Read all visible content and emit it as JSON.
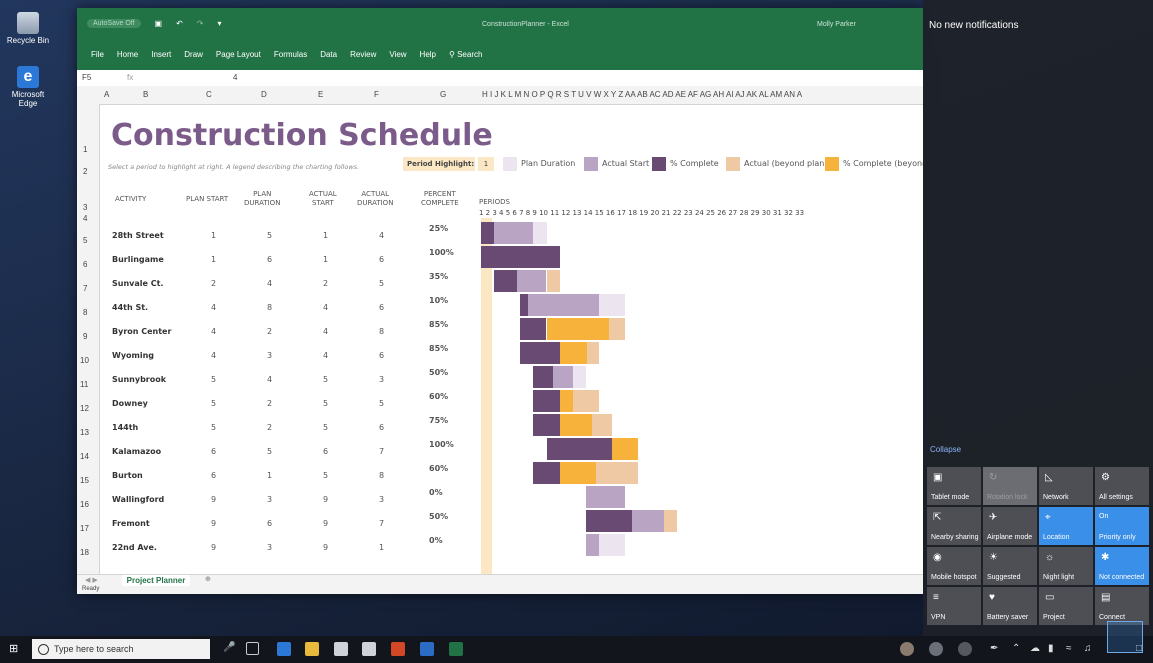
{
  "desktop": {
    "icons": [
      {
        "label": "Recycle Bin"
      },
      {
        "label": "Microsoft Edge"
      }
    ]
  },
  "excel": {
    "qat": {
      "autosave": "AutoSave",
      "autosave_state": "Off"
    },
    "doc_title": "ConstructionPlanner - Excel",
    "user": "Molly Parker",
    "menu": [
      "File",
      "Home",
      "Insert",
      "Draw",
      "Page Layout",
      "Formulas",
      "Data",
      "Review",
      "View",
      "Help",
      "Search"
    ],
    "formula": {
      "cell_ref": "F5",
      "fx": "fx",
      "value": "4"
    },
    "columns": [
      "A",
      "B",
      "C",
      "D",
      "E",
      "F",
      "G"
    ],
    "col_letters_rest": "H I J K L M N O P Q R S T U V W X Y Z AA AB AC AD AE AF AG AH AI AJ AK AL AM AN A",
    "rows": [
      "1",
      "2",
      "3",
      "4",
      "5",
      "6",
      "7",
      "8",
      "9",
      "10",
      "11",
      "12",
      "13",
      "14",
      "15",
      "16",
      "17",
      "18"
    ],
    "title": "Construction Schedule",
    "subtitle": "Select a period to highlight at right.  A legend describing the charting follows.",
    "period_highlight_label": "Period Highlight:",
    "period_highlight_value": "1",
    "legend": [
      {
        "label": "Plan Duration",
        "color": "#ece4ee"
      },
      {
        "label": "Actual Start",
        "color": "#b9a4c4"
      },
      {
        "label": "% Complete",
        "color": "#684a72"
      },
      {
        "label": "Actual (beyond plan)",
        "color": "#efc9a4"
      },
      {
        "label": "% Complete (beyond",
        "color": "#f6b23b"
      }
    ],
    "headers": {
      "activity": "ACTIVITY",
      "plan_start": "PLAN START",
      "plan_duration_1": "PLAN",
      "plan_duration_2": "DURATION",
      "actual_start_1": "ACTUAL",
      "actual_start_2": "START",
      "actual_duration_1": "ACTUAL",
      "actual_duration_2": "DURATION",
      "percent_1": "PERCENT",
      "percent_2": "COMPLETE",
      "periods": "PERIODS"
    },
    "period_numbers": "1  2  3  4  5  6  7  8  9  10  11  12  13  14  15  16  17  18  19  20  21  22  23  24  25  26  27  28  29  30  31  32  33",
    "activities": [
      {
        "name": "28th Street",
        "plan_start": "1",
        "plan_duration": "5",
        "actual_start": "1",
        "actual_duration": "4",
        "percent": "25%"
      },
      {
        "name": "Burlingame",
        "plan_start": "1",
        "plan_duration": "6",
        "actual_start": "1",
        "actual_duration": "6",
        "percent": "100%"
      },
      {
        "name": "Sunvale Ct.",
        "plan_start": "2",
        "plan_duration": "4",
        "actual_start": "2",
        "actual_duration": "5",
        "percent": "35%"
      },
      {
        "name": "44th St.",
        "plan_start": "4",
        "plan_duration": "8",
        "actual_start": "4",
        "actual_duration": "6",
        "percent": "10%"
      },
      {
        "name": "Byron Center",
        "plan_start": "4",
        "plan_duration": "2",
        "actual_start": "4",
        "actual_duration": "8",
        "percent": "85%"
      },
      {
        "name": "Wyoming",
        "plan_start": "4",
        "plan_duration": "3",
        "actual_start": "4",
        "actual_duration": "6",
        "percent": "85%"
      },
      {
        "name": "Sunnybrook",
        "plan_start": "5",
        "plan_duration": "4",
        "actual_start": "5",
        "actual_duration": "3",
        "percent": "50%"
      },
      {
        "name": "Downey",
        "plan_start": "5",
        "plan_duration": "2",
        "actual_start": "5",
        "actual_duration": "5",
        "percent": "60%"
      },
      {
        "name": "144th",
        "plan_start": "5",
        "plan_duration": "2",
        "actual_start": "5",
        "actual_duration": "6",
        "percent": "75%"
      },
      {
        "name": "Kalamazoo",
        "plan_start": "6",
        "plan_duration": "5",
        "actual_start": "6",
        "actual_duration": "7",
        "percent": "100%"
      },
      {
        "name": "Burton",
        "plan_start": "6",
        "plan_duration": "1",
        "actual_start": "5",
        "actual_duration": "8",
        "percent": "60%"
      },
      {
        "name": "Wallingford",
        "plan_start": "9",
        "plan_duration": "3",
        "actual_start": "9",
        "actual_duration": "3",
        "percent": "0%"
      },
      {
        "name": "Fremont",
        "plan_start": "9",
        "plan_duration": "6",
        "actual_start": "9",
        "actual_duration": "7",
        "percent": "50%"
      },
      {
        "name": "22nd Ave.",
        "plan_start": "9",
        "plan_duration": "3",
        "actual_start": "9",
        "actual_duration": "1",
        "percent": "0%"
      }
    ],
    "sheet_tab": "Project Planner",
    "status": "Ready"
  },
  "action_center": {
    "notifications": "No new notifications",
    "collapse": "Collapse",
    "tiles": [
      {
        "label": "Tablet mode",
        "icon": "tablet-mode-icon",
        "state": "off"
      },
      {
        "label": "Rotation lock",
        "icon": "rotation-lock-icon",
        "state": "dim"
      },
      {
        "label": "Network",
        "icon": "network-icon",
        "state": "off"
      },
      {
        "label": "All settings",
        "icon": "settings-icon",
        "state": "off"
      },
      {
        "label": "Nearby sharing",
        "icon": "nearby-sharing-icon",
        "state": "off"
      },
      {
        "label": "Airplane mode",
        "icon": "airplane-icon",
        "state": "off"
      },
      {
        "label": "Location",
        "icon": "location-icon",
        "state": "on"
      },
      {
        "label": "Priority only",
        "icon": "focus-assist-icon",
        "state": "on",
        "sublabel": "On"
      },
      {
        "label": "Mobile hotspot",
        "icon": "hotspot-icon",
        "state": "off"
      },
      {
        "label": "Suggested",
        "icon": "brightness-icon",
        "state": "off"
      },
      {
        "label": "Night light",
        "icon": "night-light-icon",
        "state": "off"
      },
      {
        "label": "Not connected",
        "icon": "bluetooth-icon",
        "state": "on"
      },
      {
        "label": "VPN",
        "icon": "vpn-icon",
        "state": "off"
      },
      {
        "label": "Battery saver",
        "icon": "battery-saver-icon",
        "state": "off"
      },
      {
        "label": "Project",
        "icon": "project-icon",
        "state": "off"
      },
      {
        "label": "Connect",
        "icon": "connect-icon",
        "state": "off"
      }
    ]
  },
  "taskbar": {
    "search_placeholder": "Type here to search"
  }
}
